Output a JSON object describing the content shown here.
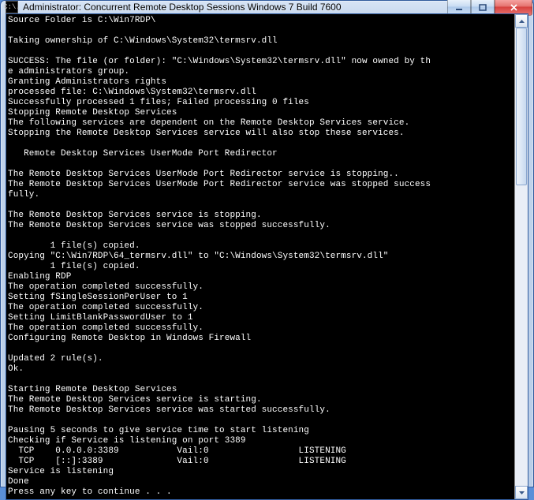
{
  "window": {
    "title": "Administrator:  Concurrent Remote Desktop Sessions Windows 7 Build 7600",
    "app_icon_glyph": "C:\\."
  },
  "controls": {
    "min_tip": "Minimize",
    "max_tip": "Maximize",
    "close_tip": "Close"
  },
  "console_lines": [
    "Source Folder is C:\\Win7RDP\\",
    "",
    "Taking ownership of C:\\Windows\\System32\\termsrv.dll",
    "",
    "SUCCESS: The file (or folder): \"C:\\Windows\\System32\\termsrv.dll\" now owned by th",
    "e administrators group.",
    "Granting Administrators rights",
    "processed file: C:\\Windows\\System32\\termsrv.dll",
    "Successfully processed 1 files; Failed processing 0 files",
    "Stopping Remote Desktop Services",
    "The following services are dependent on the Remote Desktop Services service.",
    "Stopping the Remote Desktop Services service will also stop these services.",
    "",
    "   Remote Desktop Services UserMode Port Redirector",
    "",
    "The Remote Desktop Services UserMode Port Redirector service is stopping..",
    "The Remote Desktop Services UserMode Port Redirector service was stopped success",
    "fully.",
    "",
    "The Remote Desktop Services service is stopping.",
    "The Remote Desktop Services service was stopped successfully.",
    "",
    "        1 file(s) copied.",
    "Copying \"C:\\Win7RDP\\64_termsrv.dll\" to \"C:\\Windows\\System32\\termsrv.dll\"",
    "        1 file(s) copied.",
    "Enabling RDP",
    "The operation completed successfully.",
    "Setting fSingleSessionPerUser to 1",
    "The operation completed successfully.",
    "Setting LimitBlankPasswordUser to 1",
    "The operation completed successfully.",
    "Configuring Remote Desktop in Windows Firewall",
    "",
    "Updated 2 rule(s).",
    "Ok.",
    "",
    "Starting Remote Desktop Services",
    "The Remote Desktop Services service is starting.",
    "The Remote Desktop Services service was started successfully.",
    "",
    "Pausing 5 seconds to give service time to start listening",
    "Checking if Service is listening on port 3389",
    "  TCP    0.0.0.0:3389           Vail:0                 LISTENING",
    "  TCP    [::]:3389              Vail:0                 LISTENING",
    "Service is listening",
    "Done",
    "Press any key to continue . . ."
  ]
}
